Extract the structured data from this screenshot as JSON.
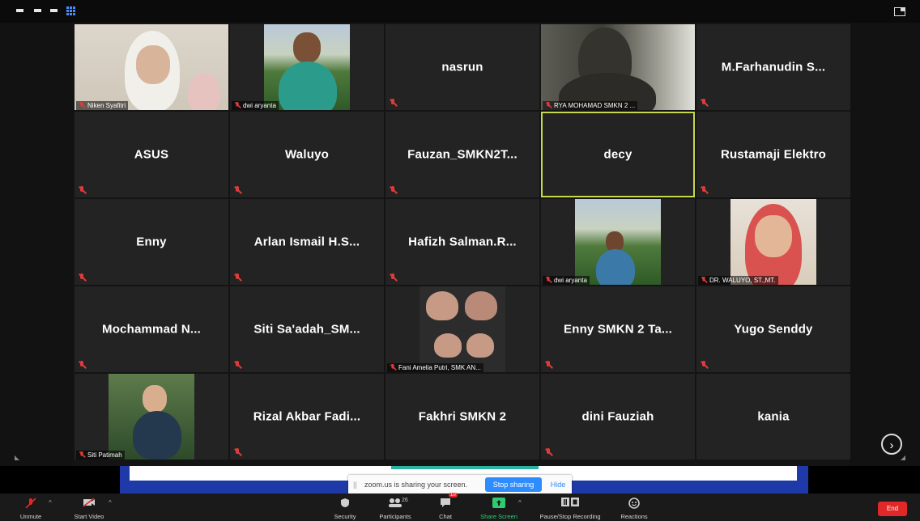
{
  "participants": [
    {
      "name": "Niken Syafitri",
      "video": true
    },
    {
      "name": "dwi aryanta",
      "video": true
    },
    {
      "name": "nasrun",
      "video": false
    },
    {
      "name": "RYA MOHAMAD SMKN 2 ...",
      "video": true
    },
    {
      "name": "M.Farhanudin S...",
      "video": false
    },
    {
      "name": "ASUS",
      "video": false
    },
    {
      "name": "Waluyo",
      "video": false
    },
    {
      "name": "Fauzan_SMKN2T...",
      "video": false
    },
    {
      "name": "decy",
      "video": false,
      "active_speaker": true
    },
    {
      "name": "Rustamaji Elektro",
      "video": false
    },
    {
      "name": "Enny",
      "video": false
    },
    {
      "name": "Arlan Ismail H.S...",
      "video": false
    },
    {
      "name": "Hafizh Salman.R...",
      "video": false
    },
    {
      "name": "dwi aryanta",
      "video": true
    },
    {
      "name": "DR. WALUYO, ST.,MT.",
      "video": true
    },
    {
      "name": "Mochammad N...",
      "video": false
    },
    {
      "name": "Siti Sa'adah_SM...",
      "video": false
    },
    {
      "name": "Fani Amelia Putri, SMK AN...",
      "video": true
    },
    {
      "name": "Enny SMKN 2 Ta...",
      "video": false
    },
    {
      "name": "Yugo Senddy",
      "video": false
    },
    {
      "name": "Siti Patimah",
      "video": true
    },
    {
      "name": "Rizal Akbar Fadi...",
      "video": false
    },
    {
      "name": "Fakhri SMKN 2",
      "video": false
    },
    {
      "name": "dini Fauziah",
      "video": false
    },
    {
      "name": "kania",
      "video": false
    }
  ],
  "share_bar": {
    "message": "zoom.us is sharing your screen.",
    "stop_label": "Stop sharing",
    "hide_label": "Hide"
  },
  "toolbar": {
    "unmute": "Unmute",
    "start_video": "Start Video",
    "security": "Security",
    "participants": "Participants",
    "participants_count": "26",
    "chat": "Chat",
    "chat_badge": "10",
    "share_screen": "Share Screen",
    "record": "Pause/Stop Recording",
    "reactions": "Reactions",
    "end": "End"
  },
  "colors": {
    "accent": "#2d8cff",
    "active_speaker_border": "#c7d84a",
    "end_button": "#e02828",
    "share_screen_label": "#2ecc71"
  }
}
